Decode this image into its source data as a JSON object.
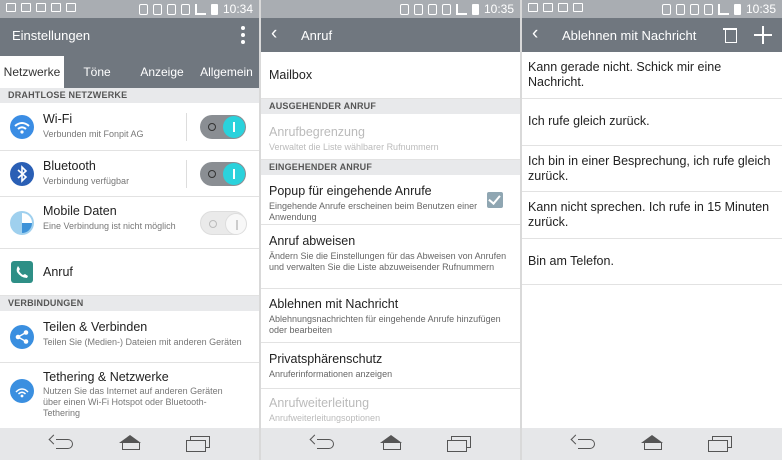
{
  "status": {
    "time_1": "10:34",
    "time_2": "10:35",
    "time_3": "10:35"
  },
  "colors": {
    "appbar": "#70777f",
    "accent": "#2ad2dc",
    "section_bg": "#e8e9eb"
  },
  "settings": {
    "title": "Einstellungen",
    "tabs": [
      "Netzwerke",
      "Töne",
      "Anzeige",
      "Allgemein"
    ],
    "section_wireless": "DRAHTLOSE NETZWERKE",
    "section_connections": "VERBINDUNGEN",
    "items": [
      {
        "title": "Wi-Fi",
        "subtitle": "Verbunden mit Fonpit AG",
        "icon": "wifi-icon",
        "toggle": "on"
      },
      {
        "title": "Bluetooth",
        "subtitle": "Verbindung verfügbar",
        "icon": "bluetooth-icon",
        "toggle": "on"
      },
      {
        "title": "Mobile Daten",
        "subtitle": "Eine Verbindung ist nicht möglich",
        "icon": "mobile-data-icon",
        "toggle": "off"
      },
      {
        "title": "Anruf",
        "subtitle": "",
        "icon": "phone-icon"
      }
    ],
    "connections": [
      {
        "title": "Teilen & Verbinden",
        "subtitle": "Teilen Sie (Medien-) Dateien mit anderen Geräten",
        "icon": "share-icon"
      },
      {
        "title": "Tethering & Netzwerke",
        "subtitle": "Nutzen Sie das Internet auf anderen Geräten über einen Wi-Fi Hotspot oder Bluetooth-Tethering",
        "icon": "tethering-icon"
      }
    ]
  },
  "call": {
    "title": "Anruf",
    "mailbox": "Mailbox",
    "section_outgoing": "AUSGEHENDER ANRUF",
    "restriction_title": "Anrufbegrenzung",
    "restriction_sub": "Verwaltet die Liste wählbarer Rufnummern",
    "section_incoming": "EINGEHENDER ANRUF",
    "popup_title": "Popup für eingehende Anrufe",
    "popup_sub": "Eingehende Anrufe erscheinen beim Benutzen einer Anwendung",
    "reject_title": "Anruf abweisen",
    "reject_sub": "Ändern Sie die Einstellungen für das Abweisen von Anrufen und verwalten Sie die Liste abzuweisender Rufnummern",
    "msg_title": "Ablehnen mit Nachricht",
    "msg_sub": "Ablehnungsnachrichten für eingehende Anrufe hinzufügen oder bearbeiten",
    "privacy_title": "Privatsphärenschutz",
    "privacy_sub": "Anruferinformationen anzeigen",
    "forward_title": "Anrufweiterleitung",
    "forward_sub": "Anrufweiterleitungsoptionen"
  },
  "reject_msg": {
    "title": "Ablehnen mit Nachricht",
    "messages": [
      "Kann gerade nicht. Schick mir eine Nachricht.",
      "Ich rufe gleich zurück.",
      "Ich bin in einer Besprechung, ich rufe gleich zurück.",
      "Kann nicht sprechen. Ich rufe in 15 Minuten zurück.",
      "Bin am Telefon."
    ]
  }
}
